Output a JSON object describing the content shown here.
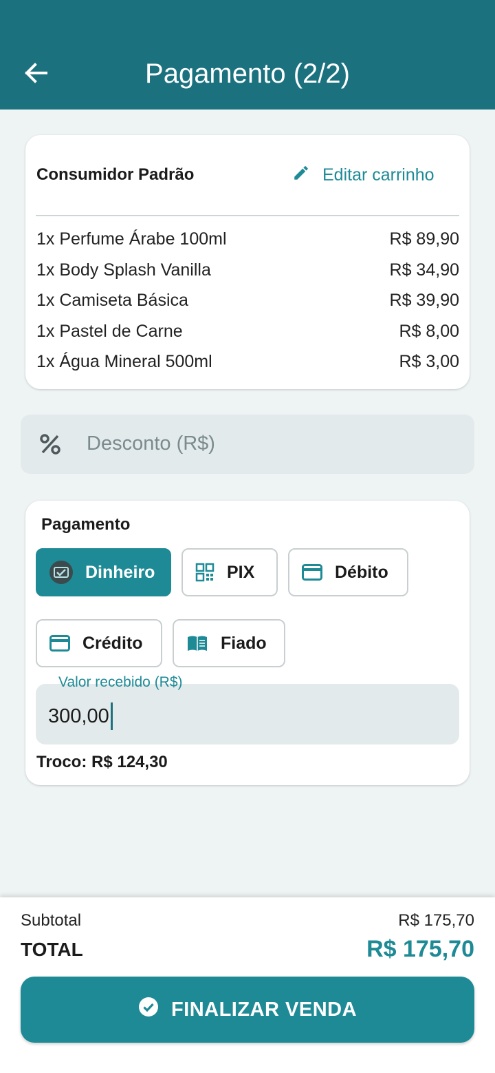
{
  "app_bar": {
    "title": "Pagamento (2/2)",
    "back_icon": "arrow-left-icon"
  },
  "cart": {
    "customer": "Consumidor Padrão",
    "edit_label": "Editar carrinho",
    "items": [
      {
        "name": "1x Perfume Árabe 100ml",
        "price": "R$ 89,90"
      },
      {
        "name": "1x Body Splash Vanilla",
        "price": "R$ 34,90"
      },
      {
        "name": "1x Camiseta Básica",
        "price": "R$ 39,90"
      },
      {
        "name": "1x Pastel de Carne",
        "price": "R$ 8,00"
      },
      {
        "name": "1x Água Mineral 500ml",
        "price": "R$ 3,00"
      }
    ]
  },
  "discount": {
    "placeholder": "Desconto (R$)",
    "icon": "percent-icon"
  },
  "payment": {
    "title": "Pagamento",
    "methods": [
      {
        "label": "Dinheiro",
        "icon": "cash-icon",
        "selected": true
      },
      {
        "label": "PIX",
        "icon": "qr-code-icon",
        "selected": false
      },
      {
        "label": "Débito",
        "icon": "credit-card-icon",
        "selected": false
      },
      {
        "label": "Crédito",
        "icon": "credit-card-icon",
        "selected": false
      },
      {
        "label": "Fiado",
        "icon": "book-icon",
        "selected": false
      }
    ],
    "received_label": "Valor recebido (R$)",
    "received_value": "300,00",
    "change": "Troco: R$ 124,30"
  },
  "summary": {
    "subtotal_label": "Subtotal",
    "subtotal_value": "R$ 175,70",
    "total_label": "TOTAL",
    "total_value": "R$ 175,70",
    "finalize_label": "FINALIZAR VENDA"
  },
  "colors": {
    "primary": "#1b717e",
    "accent": "#1e8a96",
    "background": "#eef3f4"
  }
}
